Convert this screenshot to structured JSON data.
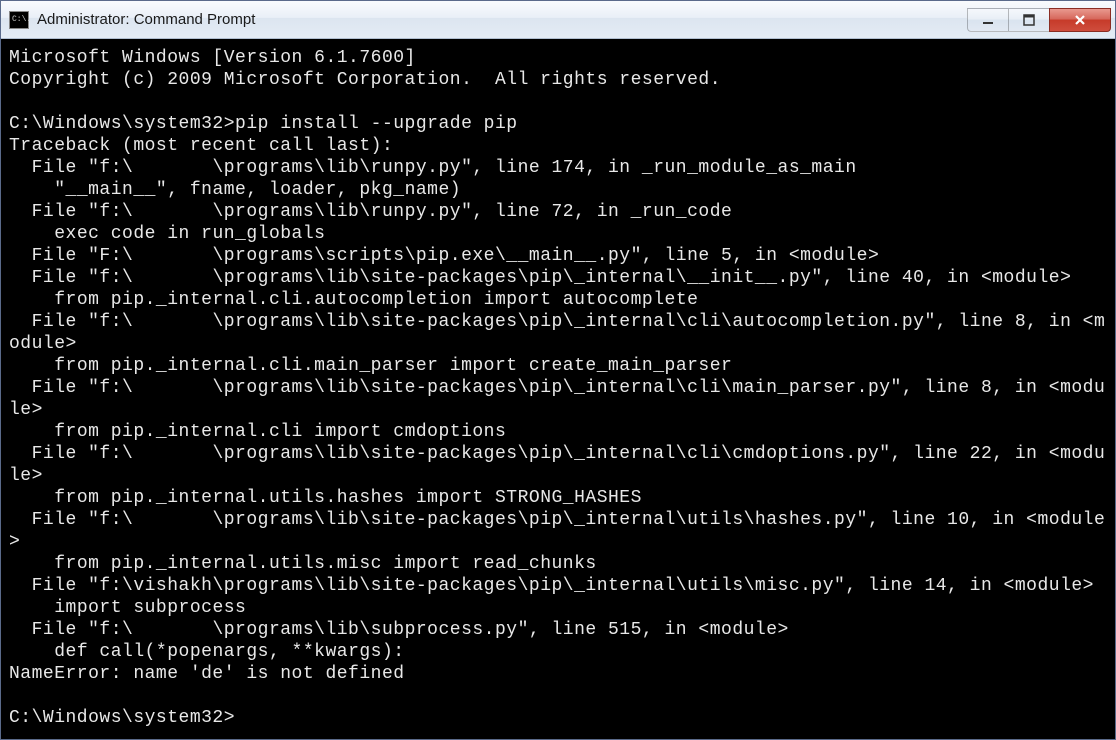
{
  "window": {
    "title": "Administrator: Command Prompt",
    "icon_label": "C:\\."
  },
  "terminal": {
    "lines": [
      "Microsoft Windows [Version 6.1.7600]",
      "Copyright (c) 2009 Microsoft Corporation.  All rights reserved.",
      "",
      "C:\\Windows\\system32>pip install --upgrade pip",
      "Traceback (most recent call last):",
      "  File \"f:\\       \\programs\\lib\\runpy.py\", line 174, in _run_module_as_main",
      "    \"__main__\", fname, loader, pkg_name)",
      "  File \"f:\\       \\programs\\lib\\runpy.py\", line 72, in _run_code",
      "    exec code in run_globals",
      "  File \"F:\\       \\programs\\scripts\\pip.exe\\__main__.py\", line 5, in <module>",
      "  File \"f:\\       \\programs\\lib\\site-packages\\pip\\_internal\\__init__.py\", line 40, in <module>",
      "    from pip._internal.cli.autocompletion import autocomplete",
      "  File \"f:\\       \\programs\\lib\\site-packages\\pip\\_internal\\cli\\autocompletion.py\", line 8, in <module>",
      "    from pip._internal.cli.main_parser import create_main_parser",
      "  File \"f:\\       \\programs\\lib\\site-packages\\pip\\_internal\\cli\\main_parser.py\", line 8, in <module>",
      "    from pip._internal.cli import cmdoptions",
      "  File \"f:\\       \\programs\\lib\\site-packages\\pip\\_internal\\cli\\cmdoptions.py\", line 22, in <module>",
      "    from pip._internal.utils.hashes import STRONG_HASHES",
      "  File \"f:\\       \\programs\\lib\\site-packages\\pip\\_internal\\utils\\hashes.py\", line 10, in <module>",
      "    from pip._internal.utils.misc import read_chunks",
      "  File \"f:\\vishakh\\programs\\lib\\site-packages\\pip\\_internal\\utils\\misc.py\", line 14, in <module>",
      "    import subprocess",
      "  File \"f:\\       \\programs\\lib\\subprocess.py\", line 515, in <module>",
      "    def call(*popenargs, **kwargs):",
      "NameError: name 'de' is not defined",
      "",
      "C:\\Windows\\system32>"
    ]
  }
}
